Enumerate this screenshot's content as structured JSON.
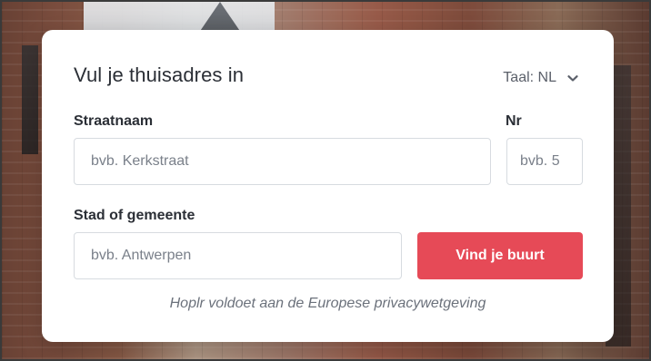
{
  "card": {
    "title": "Vul je thuisadres in",
    "language": {
      "label": "Taal: NL",
      "icon": "chevron-down-icon"
    },
    "fields": {
      "street": {
        "label": "Straatnaam",
        "placeholder": "bvb. Kerkstraat",
        "value": ""
      },
      "number": {
        "label": "Nr",
        "placeholder": "bvb. 5",
        "value": ""
      },
      "city": {
        "label": "Stad of gemeente",
        "placeholder": "bvb. Antwerpen",
        "value": ""
      }
    },
    "submit_button": {
      "label": "Vind je buurt",
      "color": "#e64a57"
    },
    "privacy_note": "Hoplr voldoet aan de Europese privacywetgeving"
  }
}
